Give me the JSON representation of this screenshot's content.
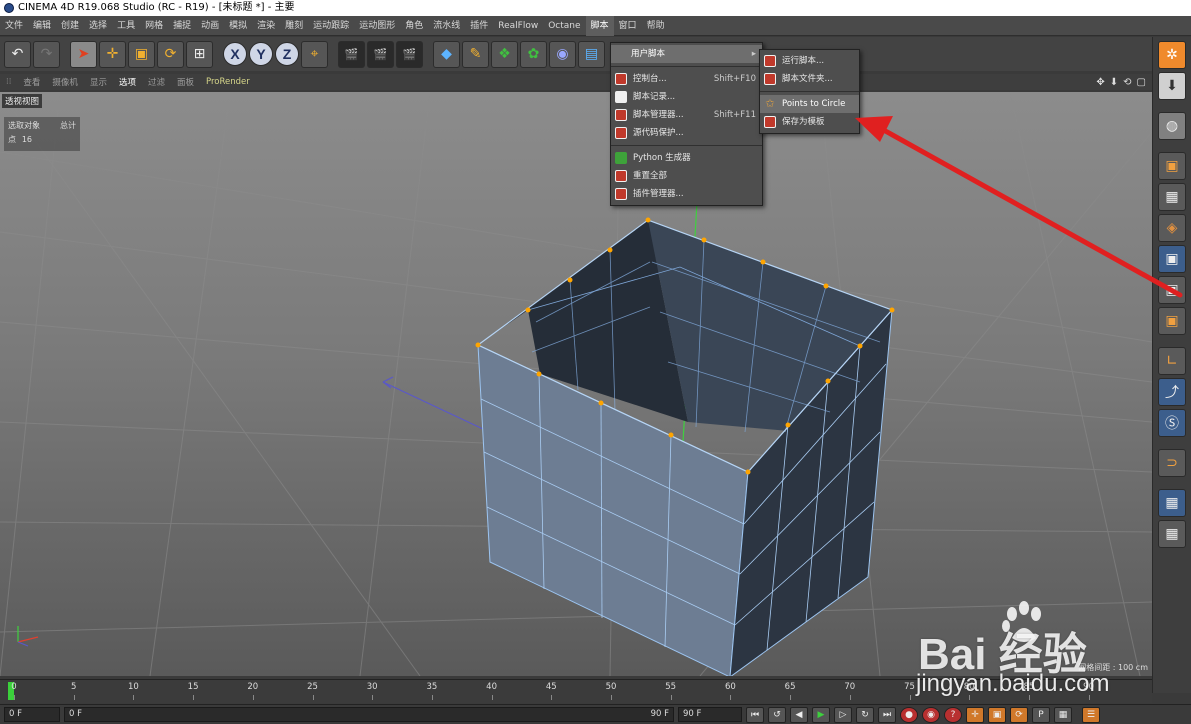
{
  "window": {
    "title": "CINEMA 4D R19.068 Studio (RC - R19) - [未标题 *] - 主要"
  },
  "menubar": {
    "items": [
      "文件",
      "编辑",
      "创建",
      "选择",
      "工具",
      "网格",
      "捕捉",
      "动画",
      "模拟",
      "渲染",
      "雕刻",
      "运动跟踪",
      "运动图形",
      "角色",
      "流水线",
      "插件",
      "RealFlow",
      "Octane",
      "脚本",
      "窗口",
      "帮助"
    ],
    "active": "脚本"
  },
  "toolbar": {
    "axis_x": "X",
    "axis_y": "Y",
    "axis_z": "Z"
  },
  "viewport_menu": {
    "items": [
      "查看",
      "摄像机",
      "显示",
      "选项",
      "过滤",
      "面板",
      "ProRender"
    ],
    "active": "选项"
  },
  "viewport": {
    "title": "透视视图",
    "stats": {
      "label_selected": "选取对象",
      "value_selected": "总计",
      "label_points": "点",
      "value_points": "16"
    },
    "grid_readout": "网格间距 : 100 cm"
  },
  "script_menu": {
    "header": "用户脚本",
    "items": [
      {
        "label": "控制台...",
        "shortcut": "Shift+F10",
        "icon": "console-icon"
      },
      {
        "label": "脚本记录...",
        "shortcut": "",
        "icon": "script-log-icon"
      },
      {
        "label": "脚本管理器...",
        "shortcut": "Shift+F11",
        "icon": "script-manager-icon"
      },
      {
        "label": "源代码保护...",
        "shortcut": "",
        "icon": "code-protect-icon"
      },
      {
        "label": "Python 生成器",
        "shortcut": "",
        "icon": "python-icon"
      },
      {
        "label": "重置全部",
        "shortcut": "",
        "icon": "reset-icon"
      },
      {
        "label": "插件管理器...",
        "shortcut": "",
        "icon": "plugin-manager-icon"
      }
    ]
  },
  "user_scripts_menu": {
    "items": [
      {
        "label": "运行脚本...",
        "icon": "run-script-icon"
      },
      {
        "label": "脚本文件夹...",
        "icon": "script-folder-icon"
      },
      {
        "label": "Points to Circle",
        "icon": "star-icon"
      },
      {
        "label": "保存为模板",
        "icon": "save-template-icon"
      }
    ],
    "selected": "Points to Circle"
  },
  "timeline": {
    "ticks": [
      "0",
      "5",
      "10",
      "15",
      "20",
      "25",
      "30",
      "35",
      "40",
      "45",
      "50",
      "55",
      "60",
      "65",
      "70",
      "75",
      "80",
      "85",
      "90"
    ],
    "current_frame": "0"
  },
  "controls": {
    "start_frame": "0 F",
    "range_start": "0 F",
    "range_end": "90 F",
    "end_frame": "90 F",
    "current": "0 F"
  },
  "watermark": {
    "brand": "Bai  经验",
    "url": "jingyan.baidu.com"
  },
  "colors": {
    "accent_orange": "#f08a2c",
    "selection_blue": "#7fa7d8",
    "point_orange": "#ffa500",
    "arrow_red": "#e02020"
  }
}
